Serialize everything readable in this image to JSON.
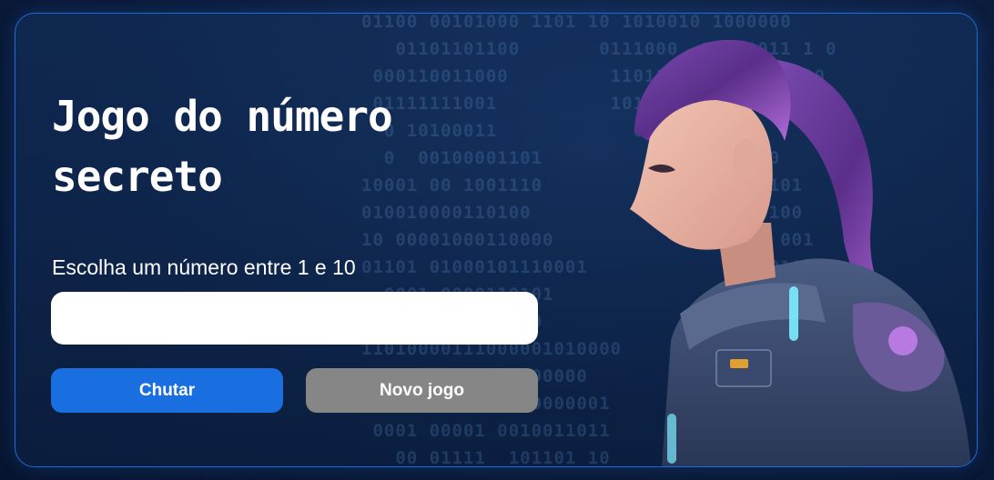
{
  "game": {
    "title": "Jogo do número secreto",
    "instruction": "Escolha um número entre 1 e 10",
    "input_value": "",
    "guess_button_label": "Chutar",
    "new_game_button_label": "Novo jogo"
  },
  "theme": {
    "background": "#0b1c3c",
    "border": "#1f6bd6",
    "guess_button": "#1a6fe0",
    "new_game_button": "#868686",
    "text": "#ffffff"
  },
  "decor": {
    "background_pattern": "binary-code",
    "illustration": "female-astronaut-purple-hair"
  }
}
